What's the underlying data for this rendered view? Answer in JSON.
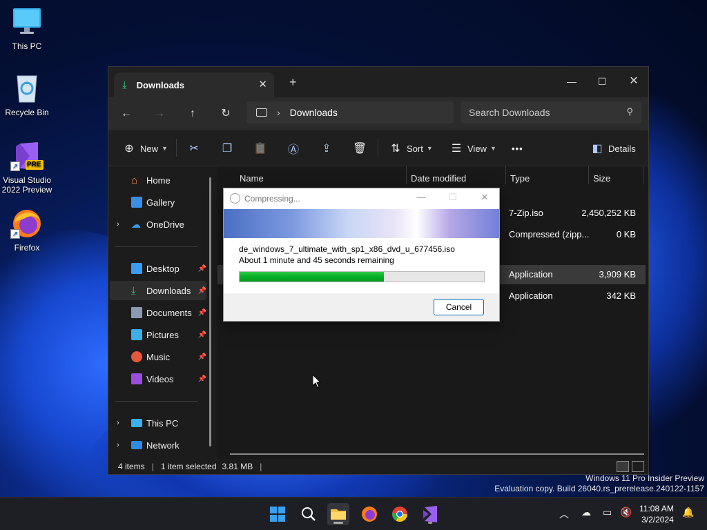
{
  "desktop": {
    "icons": [
      {
        "label": "This PC"
      },
      {
        "label": "Recycle Bin"
      },
      {
        "label": "Visual Studio 2022 Preview",
        "badge": "PRE"
      },
      {
        "label": "Firefox"
      }
    ]
  },
  "explorer": {
    "tab_title": "Downloads",
    "address": {
      "location": "Downloads"
    },
    "search_placeholder": "Search Downloads",
    "toolbar": {
      "new_label": "New",
      "sort_label": "Sort",
      "view_label": "View",
      "more_label": "•••",
      "details_label": "Details"
    },
    "sidebar": {
      "home": "Home",
      "gallery": "Gallery",
      "onedrive": "OneDrive",
      "desktop": "Desktop",
      "downloads": "Downloads",
      "documents": "Documents",
      "pictures": "Pictures",
      "music": "Music",
      "videos": "Videos",
      "thispc": "This PC",
      "network": "Network"
    },
    "columns": {
      "name": "Name",
      "date": "Date modified",
      "type": "Type",
      "size": "Size"
    },
    "rows": [
      {
        "type": "7-Zip.iso",
        "size": "2,450,252 KB",
        "selected": false
      },
      {
        "type": "Compressed (zipp...",
        "size": "0 KB",
        "selected": false
      },
      {
        "type": "Application",
        "size": "3,909 KB",
        "selected": true
      },
      {
        "type": "Application",
        "size": "342 KB",
        "selected": false
      }
    ],
    "status": {
      "items": "4 items",
      "selection": "1 item selected",
      "size": "3.81 MB"
    }
  },
  "dialog": {
    "title": "Compressing...",
    "filename": "de_windows_7_ultimate_with_sp1_x86_dvd_u_677456.iso",
    "remaining": "About 1 minute and 45 seconds remaining",
    "progress": 0.59,
    "cancel_label": "Cancel"
  },
  "watermark": {
    "line1": "Windows 11 Pro Insider Preview",
    "line2": "Evaluation copy. Build 26040.rs_prerelease.240122-1157"
  },
  "taskbar": {
    "time": "11:08 AM",
    "date": "3/2/2024"
  },
  "colors": {
    "accent": "#0067c0",
    "progress": "#06b025",
    "window_bg": "#1c1c1c",
    "selection": "#3a3a3a"
  }
}
